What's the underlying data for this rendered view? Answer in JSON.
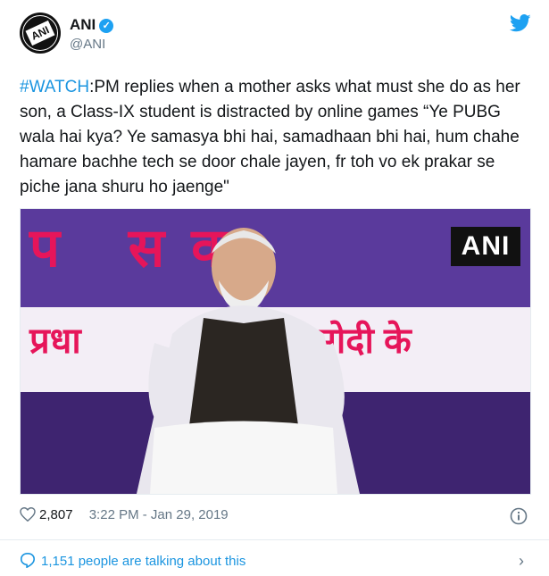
{
  "account": {
    "name": "ANI",
    "handle": "@ANI",
    "avatar_text": "ANI"
  },
  "tweet": {
    "hashtag": "#WATCH",
    "body": ":PM replies when a mother asks what must she do as her son, a Class-IX student is distracted by online games “Ye PUBG wala hai kya? Ye samasya bhi hai, samadhaan bhi hai, hum chahe hamare bachhe tech se door chale jayen, fr toh vo ek prakar se piche jana shuru ho jaenge\""
  },
  "media": {
    "watermark": "ANI",
    "banner_top": "प सवा",
    "banner_left": "प्रधा",
    "banner_right": "मोदी के"
  },
  "meta": {
    "likes": "2,807",
    "timestamp": "3:22 PM - Jan 29, 2019"
  },
  "footer": {
    "talking": "1,151 people are talking about this"
  },
  "colors": {
    "link": "#1b95e0",
    "verified": "#1da1f2",
    "secondary_text": "#657786"
  }
}
